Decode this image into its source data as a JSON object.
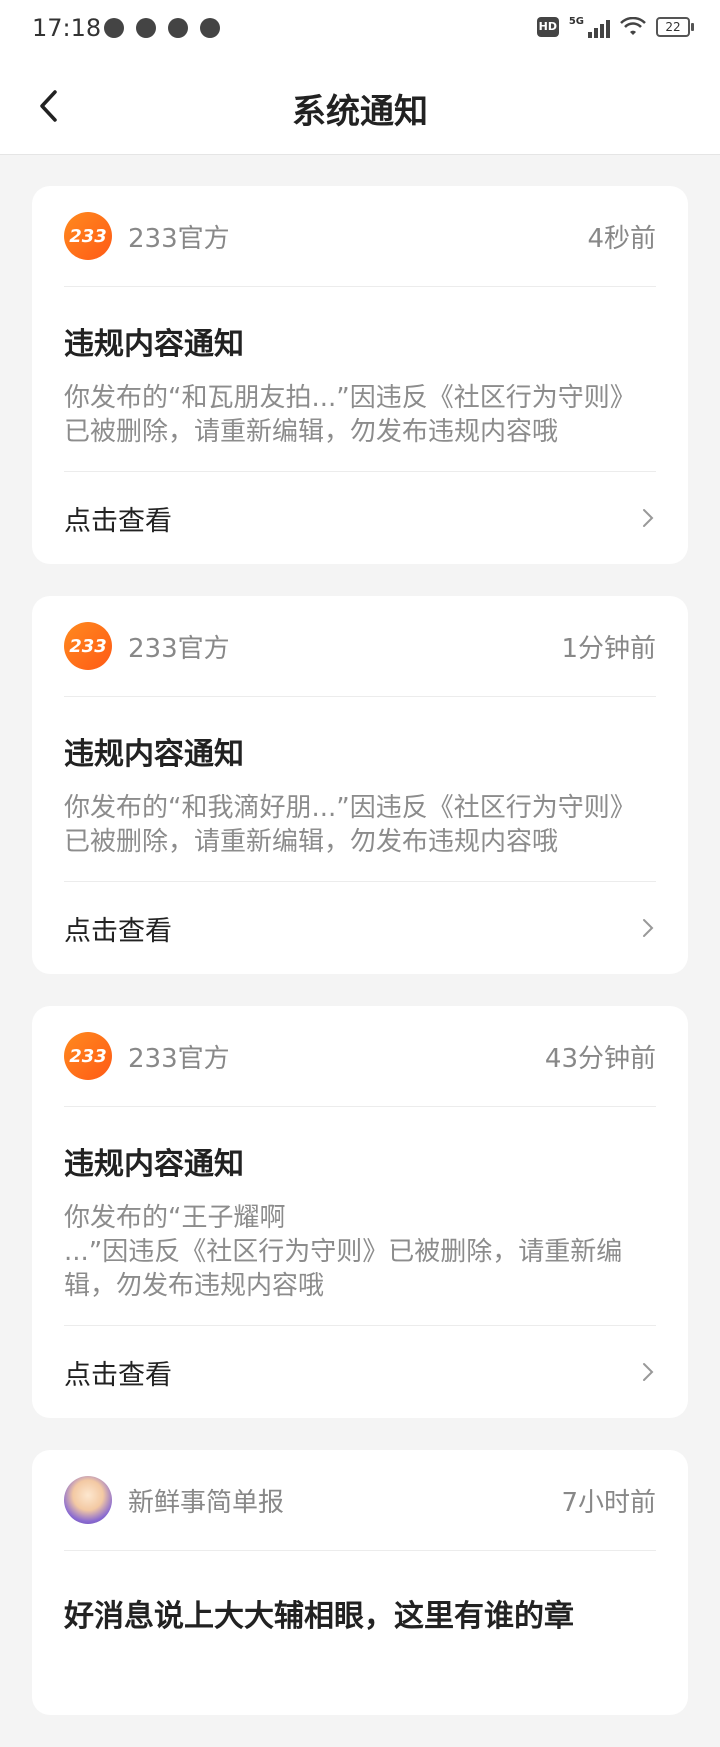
{
  "status_bar": {
    "time": "17:18",
    "network": "5G",
    "hd": "HD",
    "battery": "22"
  },
  "header": {
    "title": "系统通知",
    "back_icon": "chevron-left-icon"
  },
  "notifications": [
    {
      "sender": "233官方",
      "avatar_text": "233",
      "time": "4秒前",
      "title": "违规内容通知",
      "text": "你发布的“和瓦朋友拍...”因违反《社区行为守则》已被删除，请重新编辑，勿发布违规内容哦",
      "action": "点击查看"
    },
    {
      "sender": "233官方",
      "avatar_text": "233",
      "time": "1分钟前",
      "title": "违规内容通知",
      "text": "你发布的“和我滴好朋...”因违反《社区行为守则》已被删除，请重新编辑，勿发布违规内容哦",
      "action": "点击查看"
    },
    {
      "sender": "233官方",
      "avatar_text": "233",
      "time": "43分钟前",
      "title": "违规内容通知",
      "text_line1": "你发布的“王子耀啊",
      "text_line2": "...”因违反《社区行为守则》已被删除，请重新编辑，勿发布违规内容哦",
      "action": "点击查看"
    },
    {
      "sender": "新鲜事简单报",
      "time": "7小时前",
      "title": "好消息说上大大辅相眼，这里有谁的章"
    }
  ],
  "colors": {
    "accent_orange": "#ff6a1a",
    "background": "#f4f4f4",
    "card": "#ffffff",
    "muted_text": "#888888"
  }
}
